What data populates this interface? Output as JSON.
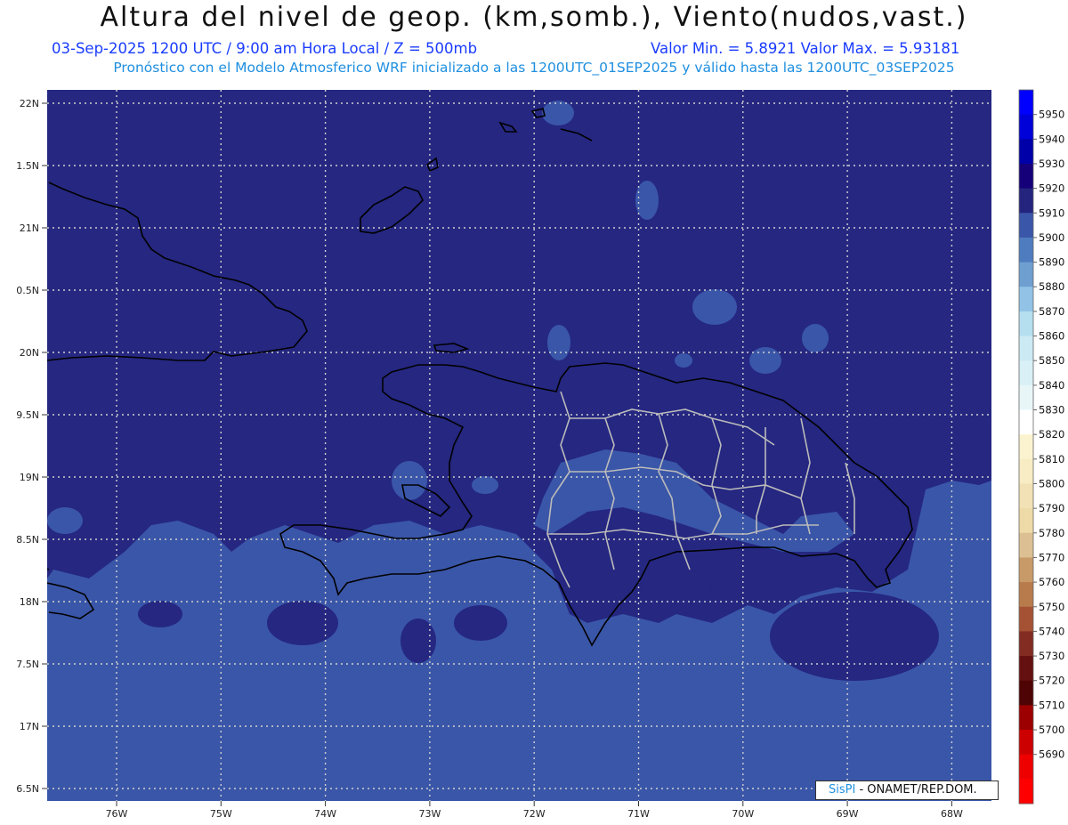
{
  "title": "Altura del nivel de geop. (km,somb.), Viento(nudos,vast.)",
  "subtitle_left": "03-Sep-2025  1200 UTC / 9:00 am Hora Local / Z = 500mb",
  "subtitle_right": "Valor Min. = 5.8921  Valor Max. = 5.93181",
  "subtitle2": "Pronóstico con el Modelo Atmosferico WRF inicializado a las 1200UTC_01SEP2025 y válido hasta las  1200UTC_03SEP2025",
  "lat_labels": [
    "22N",
    "1.5N",
    "21N",
    "0.5N",
    "20N",
    "9.5N",
    "19N",
    "8.5N",
    "18N",
    "7.5N",
    "17N",
    "6.5N"
  ],
  "lon_labels": [
    "76W",
    "75W",
    "74W",
    "73W",
    "72W",
    "71W",
    "70W",
    "69W",
    "68W"
  ],
  "colorbar": {
    "labels": [
      "5950",
      "5940",
      "5930",
      "5920",
      "5910",
      "5900",
      "5890",
      "5880",
      "5870",
      "5860",
      "5850",
      "5840",
      "5830",
      "5820",
      "5810",
      "5800",
      "5790",
      "5780",
      "5770",
      "5760",
      "5750",
      "5740",
      "5730",
      "5720",
      "5710",
      "5700",
      "5690"
    ],
    "colors": [
      "#0000ff",
      "#0000d8",
      "#0000a8",
      "#16007a",
      "#24247e",
      "#3a56a8",
      "#4f7cbe",
      "#6f9fd0",
      "#92c3e6",
      "#b5deef",
      "#cbeaf4",
      "#d8f0f6",
      "#e8f6f8",
      "#ffffff",
      "#fbf3cf",
      "#f7ecc4",
      "#f1e1b5",
      "#eedaa6",
      "#dcc093",
      "#c89a68",
      "#b87c4c",
      "#a55234",
      "#822c22",
      "#651010",
      "#4e0404",
      "#9c0000",
      "#cc0000",
      "#ee0000",
      "#ff0000"
    ]
  },
  "credit_brand": "SisPI",
  "credit_text": " - ONAMET/REP.DOM."
}
